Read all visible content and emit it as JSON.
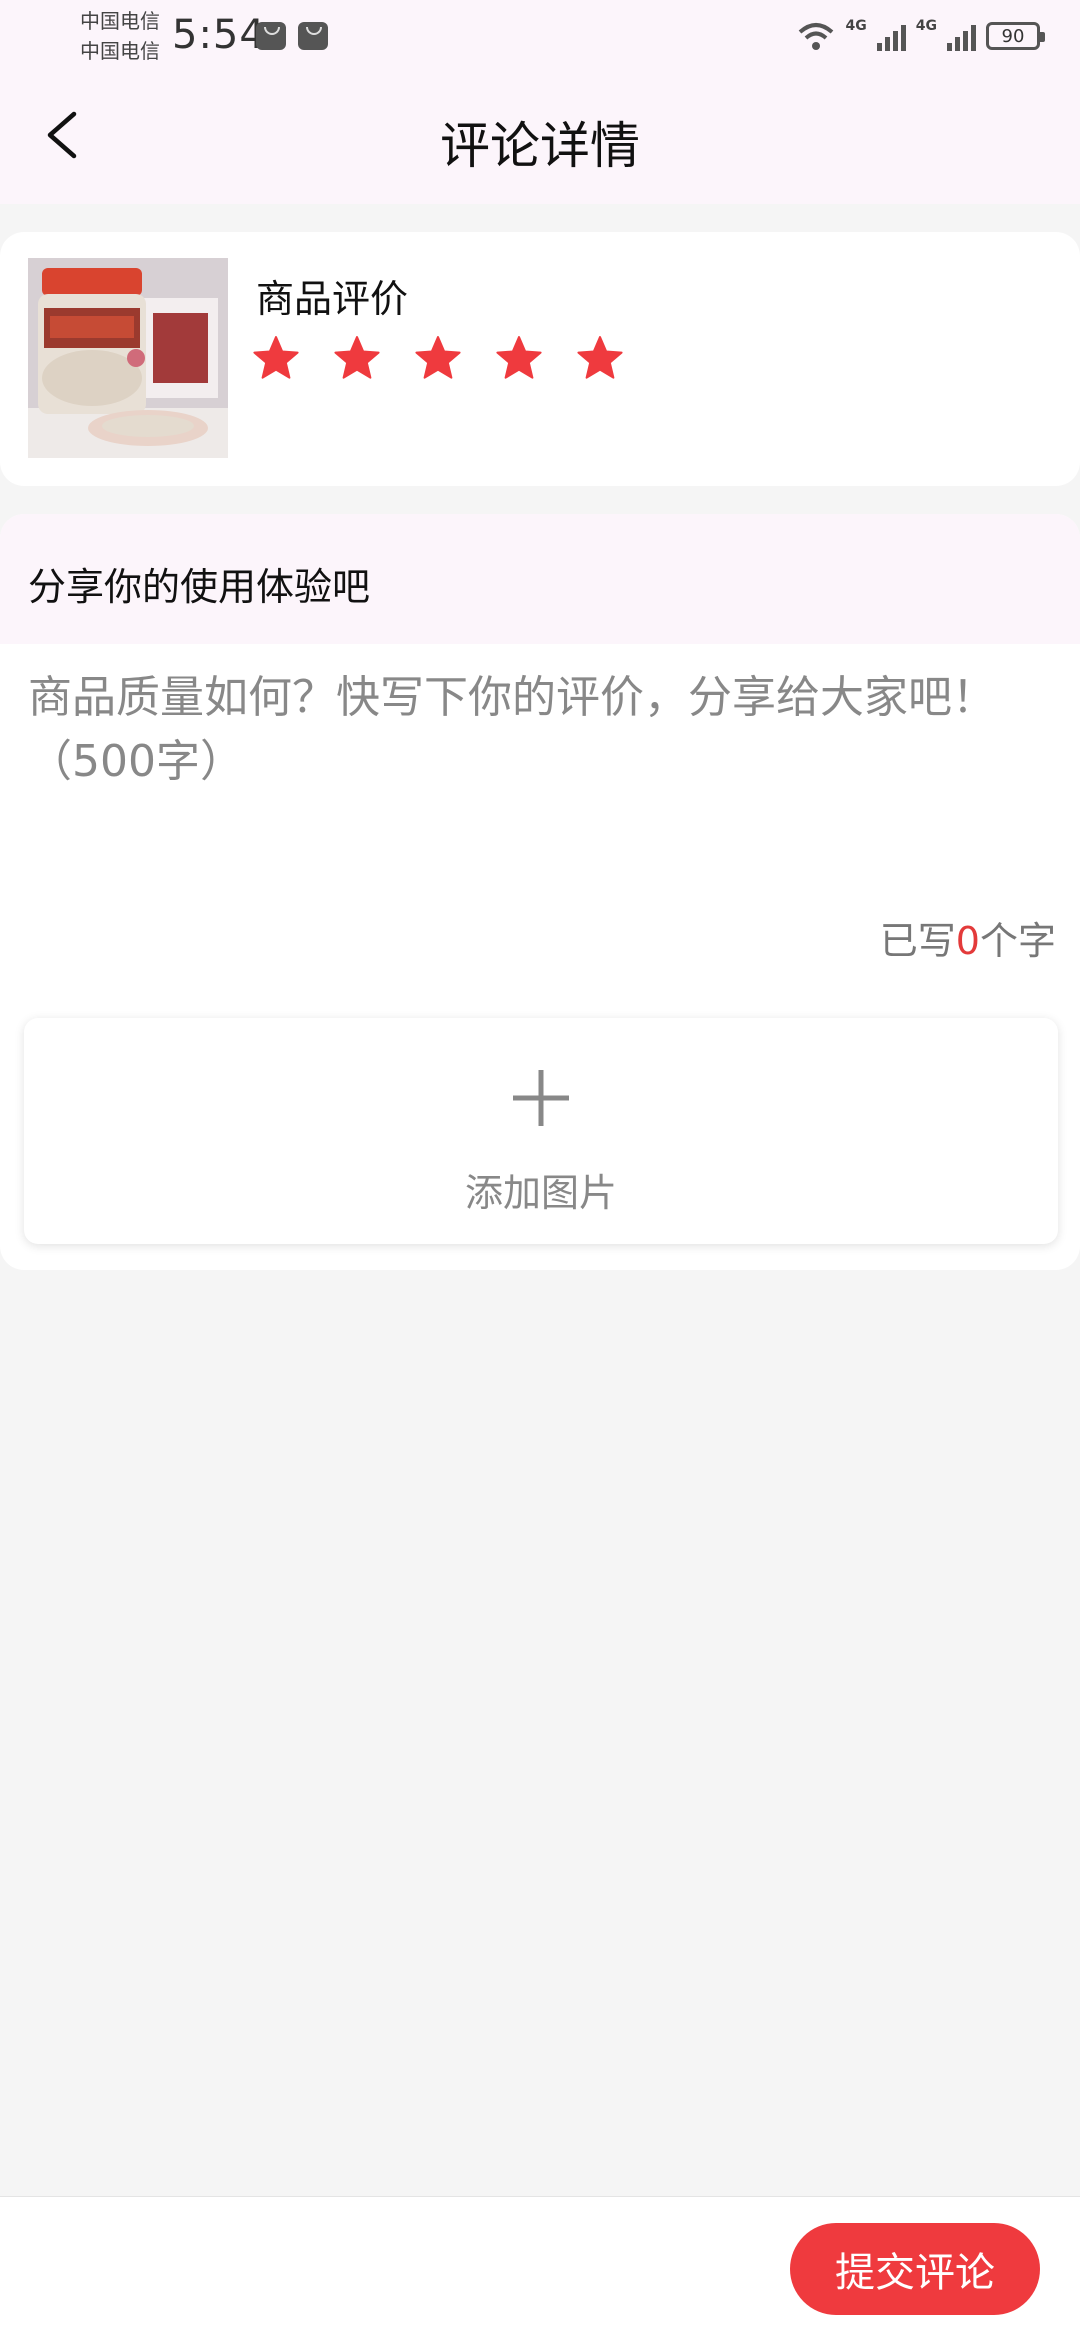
{
  "status_bar": {
    "carrier_1": "中国电信",
    "carrier_2": "中国电信",
    "time": "5:54",
    "network_1": "4G",
    "network_2": "4G",
    "battery": "90",
    "icons": [
      "huawei-app-icon",
      "huawei-app-icon",
      "wifi-icon",
      "signal-icon",
      "signal-icon",
      "battery-icon"
    ]
  },
  "nav": {
    "back_icon": "chevron-left-icon",
    "title": "评论详情"
  },
  "product": {
    "rating_label": "商品评价",
    "rating_value": 5,
    "rating_max": 5,
    "star_color": "#ef3a3e"
  },
  "review": {
    "section_title": "分享你的使用体验吧",
    "placeholder": "商品质量如何？快写下你的评价，分享给大家吧！（500字）",
    "value": "",
    "count_prefix": "已写",
    "count_value": "0",
    "count_suffix": "个字"
  },
  "add_photo": {
    "icon": "plus-icon",
    "label": "添加图片"
  },
  "footer": {
    "submit_label": "提交评论"
  },
  "colors": {
    "accent": "#ef3a3e",
    "header_bg": "#fcf5fb",
    "page_bg": "#f5f5f5"
  }
}
